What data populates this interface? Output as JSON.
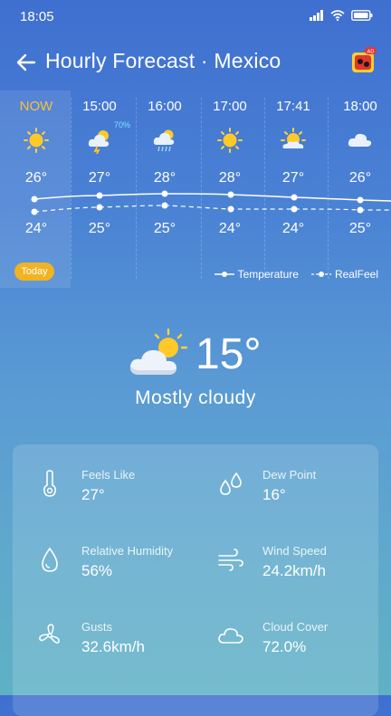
{
  "status": {
    "time": "18:05"
  },
  "header": {
    "title": "Hourly Forecast · Mexico",
    "ad_badge": "AD"
  },
  "hourly": [
    {
      "hour": "NOW",
      "icon": "sunny-icon",
      "hi": "26°",
      "lo": "24°",
      "prob": ""
    },
    {
      "hour": "15:00",
      "icon": "thunder-cloud-icon",
      "hi": "27°",
      "lo": "25°",
      "prob": "70%"
    },
    {
      "hour": "16:00",
      "icon": "rain-cloud-icon",
      "hi": "28°",
      "lo": "25°",
      "prob": ""
    },
    {
      "hour": "17:00",
      "icon": "sunny-icon",
      "hi": "28°",
      "lo": "24°",
      "prob": ""
    },
    {
      "hour": "17:41",
      "icon": "sunset-icon",
      "hi": "27°",
      "lo": "24°",
      "prob": ""
    },
    {
      "hour": "18:00",
      "icon": "cloud-icon",
      "hi": "26°",
      "lo": "25°",
      "prob": ""
    }
  ],
  "today_label": "Today",
  "legend": {
    "temperature": "Temperature",
    "realfeel": "RealFeel"
  },
  "current": {
    "temp": "15°",
    "condition": "Mostly cloudy"
  },
  "details": [
    {
      "label": "Feels Like",
      "value": "27°",
      "icon": "thermometer-icon"
    },
    {
      "label": "Dew Point",
      "value": "16°",
      "icon": "dew-drops-icon"
    },
    {
      "label": "Relative Humidity",
      "value": "56%",
      "icon": "humidity-drop-icon"
    },
    {
      "label": "Wind Speed",
      "value": "24.2km/h",
      "icon": "wind-icon"
    },
    {
      "label": "Gusts",
      "value": "32.6km/h",
      "icon": "fan-icon"
    },
    {
      "label": "Cloud Cover",
      "value": "72.0%",
      "icon": "cloud-outline-icon"
    }
  ],
  "colors": {
    "accent": "#f6c13d",
    "pill": "#f0b322",
    "rain_prob": "#7fe1ff"
  }
}
